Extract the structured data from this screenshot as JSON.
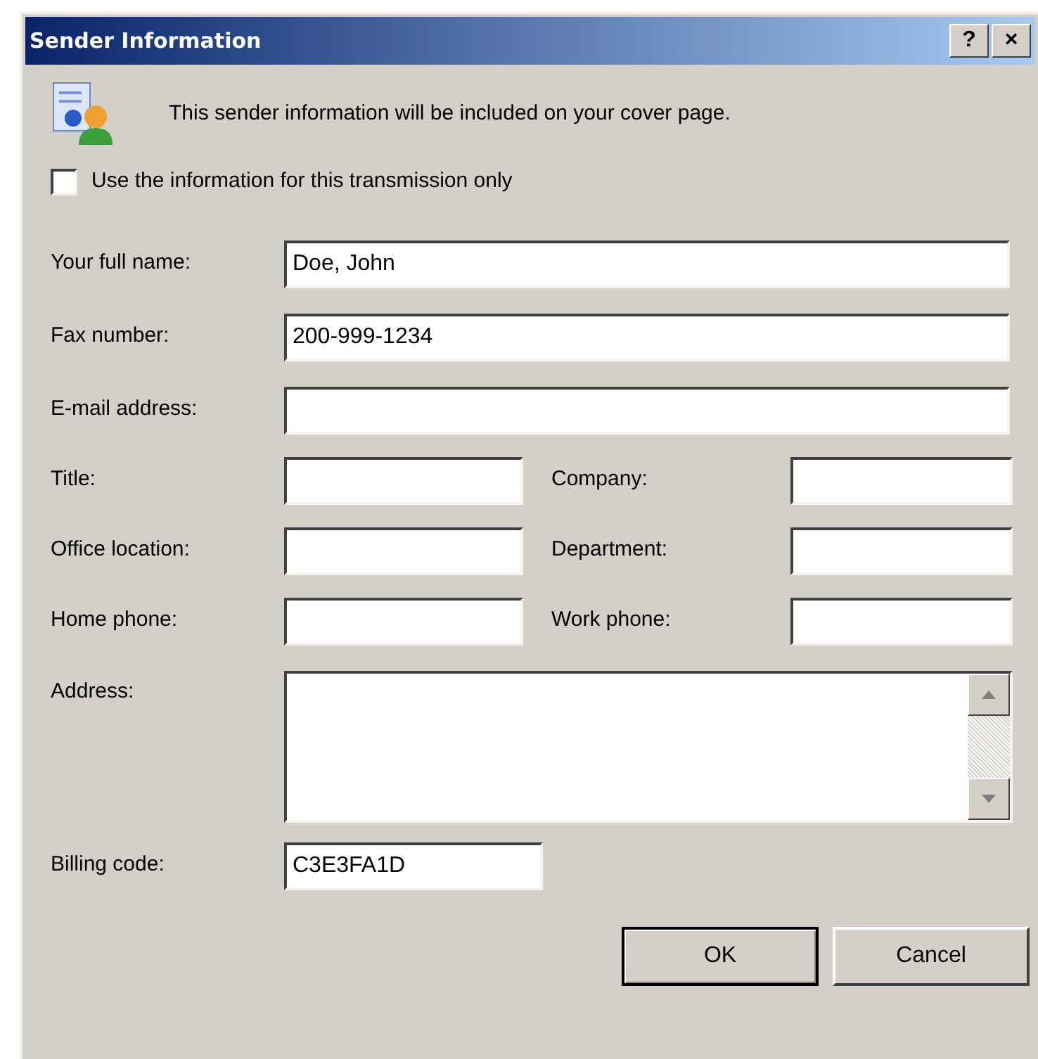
{
  "window": {
    "title": "Sender Information",
    "title_buttons": [
      "?",
      "×"
    ]
  },
  "intro": "This sender information will be included on your cover page.",
  "checkbox": {
    "label": "Use the information for this transmission only",
    "checked": false
  },
  "wide_fields": [
    {
      "label": "Your full name:",
      "value": "Doe, John"
    },
    {
      "label": "Fax number:",
      "value": "200-999-1234"
    },
    {
      "label": "E-mail address:"
    }
  ],
  "pair_rows": [
    [
      {
        "label": "Title:"
      },
      {
        "label": "Company:"
      }
    ],
    [
      {
        "label": "Office location:"
      },
      {
        "label": "Department:"
      }
    ],
    [
      {
        "label": "Home phone:"
      },
      {
        "label": "Work phone:"
      }
    ]
  ],
  "address": {
    "label": "Address:"
  },
  "billing": {
    "label": "Billing code:",
    "value": "C3E3FA1D"
  },
  "buttons": [
    {
      "label": "OK",
      "default": true
    },
    {
      "label": "Cancel",
      "default": false
    }
  ]
}
